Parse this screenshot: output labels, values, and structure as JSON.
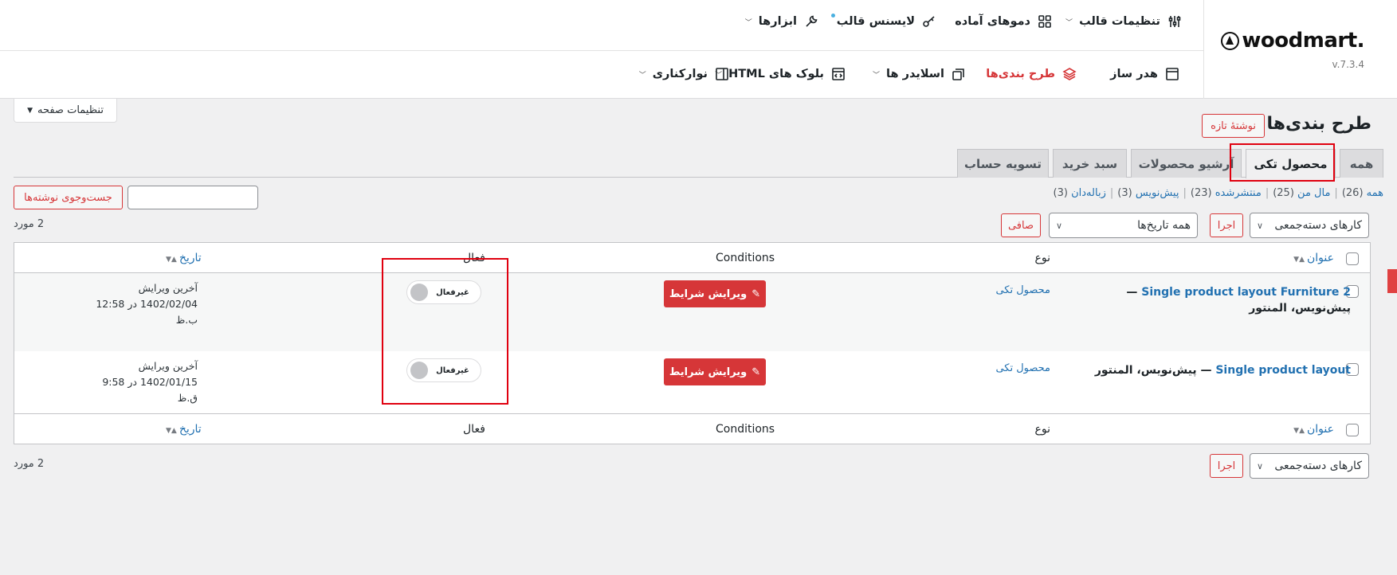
{
  "woodmart": {
    "brand": "woodmart.",
    "version": "v.7.3.4",
    "top_menu": [
      {
        "label": "تنظیمات قالب",
        "icon": "sliders-icon"
      },
      {
        "label": "دموهای آماده",
        "icon": "grid-icon"
      },
      {
        "label": "لایسنس قالب",
        "icon": "key-icon"
      },
      {
        "label": "ابزارها",
        "icon": "wrench-icon"
      }
    ],
    "sub_menu": [
      {
        "label": "هدر ساز",
        "icon": "layout-icon"
      },
      {
        "label": "طرح بندی‌ها",
        "icon": "layers-icon"
      },
      {
        "label": "اسلایدر ها",
        "icon": "slides-icon"
      },
      {
        "label": "بلوک های HTML",
        "icon": "code-window-icon"
      },
      {
        "label": "نوارکناری",
        "icon": "sidebar-icon"
      }
    ]
  },
  "screen_options": "تنظیمات صفحه",
  "page_title": "طرح بندی‌ها",
  "new_post": "نوشتهٔ تازه",
  "tabs": [
    "همه",
    "محصول تکی",
    "آرشیو محصولات",
    "سبد خرید",
    "تسویه حساب"
  ],
  "status_links": [
    {
      "label": "همه",
      "count": "(26)"
    },
    {
      "label": "مال من",
      "count": "(25)"
    },
    {
      "label": "منتشرشده",
      "count": "(23)"
    },
    {
      "label": "پیش‌نویس",
      "count": "(3)"
    },
    {
      "label": "زباله‌دان",
      "count": "(3)"
    }
  ],
  "search_button": "جست‌وجوی نوشته‌ها",
  "bulk_actions": "کارهای دسته‌جمعی",
  "apply": "اجرا",
  "dates_filter": "همه تاریخ‌ها",
  "filter_button": "صافی",
  "items_count": "2 مورد",
  "columns": {
    "title": "عنوان",
    "type": "نوع",
    "conditions": "Conditions",
    "active": "فعال",
    "date": "تاریخ"
  },
  "rows": [
    {
      "title": "Single product layout Furniture 2",
      "state": "— پیش‌نویس، المنتور",
      "type": "محصول تکی",
      "edit_button": "ویرایش شرایط",
      "toggle": "غیرفعال",
      "date_label": "آخرین ویرایش",
      "date_value": "1402/02/04 در 12:58 ب.ظ"
    },
    {
      "title": "Single product layout",
      "state": "— پیش‌نویس، المنتور",
      "type": "محصول تکی",
      "edit_button": "ویرایش شرایط",
      "toggle": "غیرفعال",
      "date_label": "آخرین ویرایش",
      "date_value": "1402/01/15 در 9:58 ق.ظ"
    }
  ],
  "colors": {
    "accent": "#d63638",
    "link": "#2271b1",
    "highlight": "#e0000f"
  }
}
